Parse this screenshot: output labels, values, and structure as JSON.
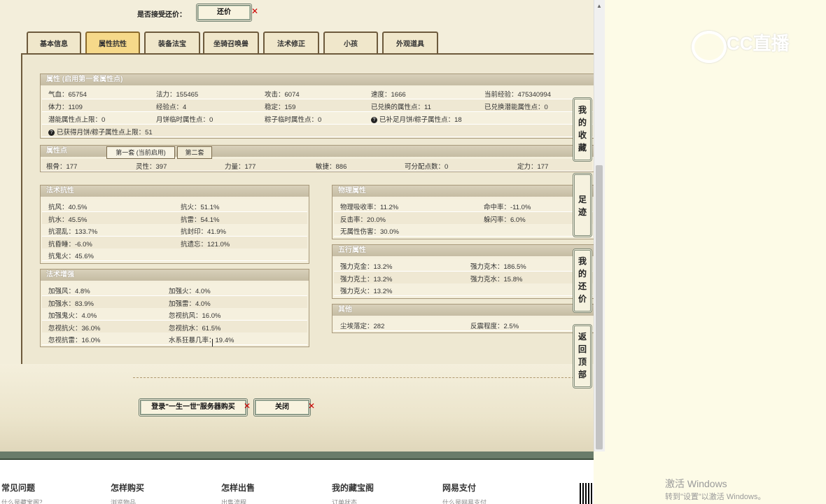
{
  "top": {
    "accept_label": "是否接受还价：",
    "counter_button": "还价"
  },
  "tabs": [
    "基本信息",
    "属性抗性",
    "装备法宝",
    "坐骑召唤兽",
    "法术修正",
    "小孩",
    "外观道具"
  ],
  "attributes": {
    "title": "属性 (启用第一套属性点)",
    "row1": [
      "气血：65754",
      "法力：155465",
      "攻击：6074",
      "速度：1666",
      "当前经验：475340994"
    ],
    "row2": [
      "体力：1109",
      "经验点：4",
      "稳定：159",
      "已兑换的属性点：11",
      "已兑换潜能属性点：0"
    ],
    "row3": [
      "潜能属性点上限：0",
      "月饼临时属性点：0",
      "粽子临时属性点：0",
      "已补足月饼/粽子属性点：18"
    ],
    "row4": [
      "已获得月饼/粽子属性点上限：51"
    ]
  },
  "points": {
    "title": "属性点",
    "tab1": "第一套 (当前启用)",
    "tab2": "第二套",
    "values": [
      "根骨：177",
      "灵性：397",
      "力量：177",
      "敏捷：886",
      "可分配点数：0",
      "定力：177"
    ]
  },
  "spell_resist": {
    "title": "法术抗性",
    "rows": [
      [
        "抗风：40.5%",
        "抗火：51.1%"
      ],
      [
        "抗水：45.5%",
        "抗雷：54.1%"
      ],
      [
        "抗混乱：133.7%",
        "抗封印：41.9%"
      ],
      [
        "抗昏睡：-6.0%",
        "抗遗忘：121.0%"
      ],
      [
        "抗鬼火：45.6%",
        ""
      ]
    ]
  },
  "spell_boost": {
    "title": "法术增强",
    "rows": [
      [
        "加强风：4.8%",
        "加强火：4.0%"
      ],
      [
        "加强水：83.9%",
        "加强雷：4.0%"
      ],
      [
        "加强鬼火：4.0%",
        "忽视抗风：16.0%"
      ],
      [
        "忽视抗火：36.0%",
        "忽视抗水：61.5%"
      ],
      [
        "忽视抗雷：16.0%",
        "水系狂暴几率：19.4%"
      ]
    ]
  },
  "physical": {
    "title": "物理属性",
    "rows": [
      [
        "物理吸收率：11.2%",
        "命中率：-11.0%"
      ],
      [
        "反击率：20.0%",
        "躲闪率：6.0%"
      ],
      [
        "无属性伤害：30.0%",
        ""
      ]
    ]
  },
  "elements": {
    "title": "五行属性",
    "rows": [
      [
        "强力克金：13.2%",
        "强力克木：186.5%"
      ],
      [
        "强力克土：13.2%",
        "强力克水：15.8%"
      ],
      [
        "强力克火：13.2%",
        ""
      ]
    ]
  },
  "other": {
    "title": "其他",
    "rows": [
      [
        "尘埃落定：282",
        "反震程度：2.5%"
      ]
    ]
  },
  "side": [
    "我的收藏",
    "足迹",
    "我的还价",
    "返回顶部"
  ],
  "bottom": {
    "login_button": "登录\"一生一世\"服务器购买",
    "close_button": "关闭"
  },
  "footer": {
    "cols": [
      "常见问题",
      "怎样购买",
      "怎样出售",
      "我的藏宝阁",
      "网易支付"
    ],
    "subs": [
      "什么是藏宝阁？",
      "浏览物品",
      "出售流程",
      "订单状态",
      "什么是网易支付"
    ]
  },
  "overlay": {
    "logo": "CC直播",
    "activate1": "激活 Windows",
    "activate2": "转到\"设置\"以激活 Windows。"
  }
}
